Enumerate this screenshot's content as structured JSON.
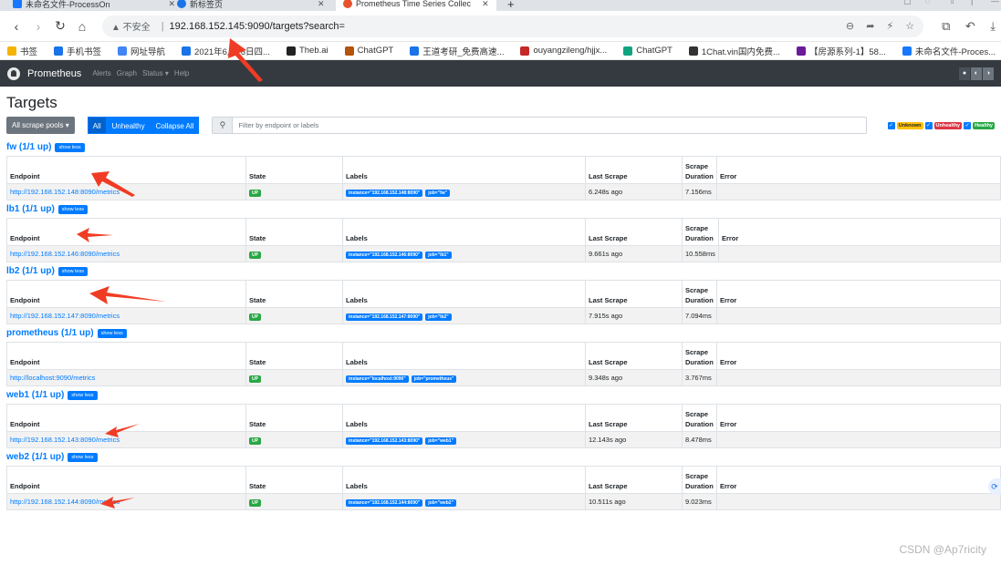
{
  "browser": {
    "tabs": [
      {
        "title": "未命名文件-ProcessOn",
        "fav_color": "#1677ff"
      },
      {
        "title": "新标签页",
        "fav_color": "#1a73e8"
      },
      {
        "title": "Prometheus Time Series Collec",
        "fav_color": "#e6522c"
      }
    ],
    "new_tab": "+",
    "back": "‹",
    "forward": "›",
    "reload": "↻",
    "home": "⌂",
    "insecure_label": "▲ 不安全",
    "url": "192.168.152.145:9090/targets?search=",
    "bookmarks": [
      {
        "label": "书签",
        "color": "#f4b400"
      },
      {
        "label": "手机书签",
        "color": "#1a73e8"
      },
      {
        "label": "网址导航",
        "color": "#4285f4"
      },
      {
        "label": "2021年6月16日四...",
        "color": "#1a73e8"
      },
      {
        "label": "Theb.ai",
        "color": "#222222"
      },
      {
        "label": "ChatGPT",
        "color": "#b45309"
      },
      {
        "label": "王道考研_免费高速...",
        "color": "#1a73e8"
      },
      {
        "label": "ouyangzileng/hjjx...",
        "color": "#c62828"
      },
      {
        "label": "ChatGPT",
        "color": "#10a37f"
      },
      {
        "label": "1Chat.vin国内免费...",
        "color": "#333333"
      },
      {
        "label": "【房源系列-1】58...",
        "color": "#6a1b9a"
      },
      {
        "label": "未命名文件-Proces...",
        "color": "#1677ff"
      }
    ]
  },
  "nav": {
    "brand": "Prometheus",
    "links": [
      "Alerts",
      "Graph",
      "Status ▾",
      "Help"
    ]
  },
  "page": {
    "title": "Targets",
    "pools_button": "All scrape pools ▾",
    "filters": [
      "All",
      "Unhealthy",
      "Collapse All"
    ],
    "search_placeholder": "Filter by endpoint or labels",
    "health": [
      "Unknown",
      "Unhealthy",
      "Healthy"
    ],
    "show_less": "show less",
    "columns": [
      "Endpoint",
      "State",
      "Labels",
      "Last Scrape",
      "Scrape Duration",
      "Error"
    ]
  },
  "pools": [
    {
      "title": "fw (1/1 up)",
      "endpoint": "http://192.168.152.148:8090/metrics",
      "state": "UP",
      "labels": [
        "instance=\"192.168.152.148:8090\"",
        "job=\"fw\""
      ],
      "last_scrape": "6.248s ago",
      "duration": "7.156ms",
      "error": ""
    },
    {
      "title": "lb1 (1/1 up)",
      "endpoint": "http://192.168.152.146:8090/metrics",
      "state": "UP",
      "labels": [
        "instance=\"192.168.152.146:8090\"",
        "job=\"lb1\""
      ],
      "last_scrape": "9.661s ago",
      "duration": "10.558ms",
      "error": ""
    },
    {
      "title": "lb2 (1/1 up)",
      "endpoint": "http://192.168.152.147:8090/metrics",
      "state": "UP",
      "labels": [
        "instance=\"192.168.152.147:8090\"",
        "job=\"lb2\""
      ],
      "last_scrape": "7.915s ago",
      "duration": "7.094ms",
      "error": ""
    },
    {
      "title": "prometheus (1/1 up)",
      "endpoint": "http://localhost:9090/metrics",
      "state": "UP",
      "labels": [
        "instance=\"localhost:9090\"",
        "job=\"prometheus\""
      ],
      "last_scrape": "9.348s ago",
      "duration": "3.767ms",
      "error": ""
    },
    {
      "title": "web1 (1/1 up)",
      "endpoint": "http://192.168.152.143:8090/metrics",
      "state": "UP",
      "labels": [
        "instance=\"192.168.152.143:8090\"",
        "job=\"web1\""
      ],
      "last_scrape": "12.143s ago",
      "duration": "8.478ms",
      "error": ""
    },
    {
      "title": "web2 (1/1 up)",
      "endpoint": "http://192.168.152.144:8090/metrics",
      "state": "UP",
      "labels": [
        "instance=\"192.168.152.144:8090\"",
        "job=\"web2\""
      ],
      "last_scrape": "10.511s ago",
      "duration": "9.023ms",
      "error": ""
    }
  ],
  "watermark": "CSDN @Ap7ricity",
  "colors": {
    "arrow": "#f03c24",
    "accent": "#007bff",
    "navbar": "#343a40"
  }
}
